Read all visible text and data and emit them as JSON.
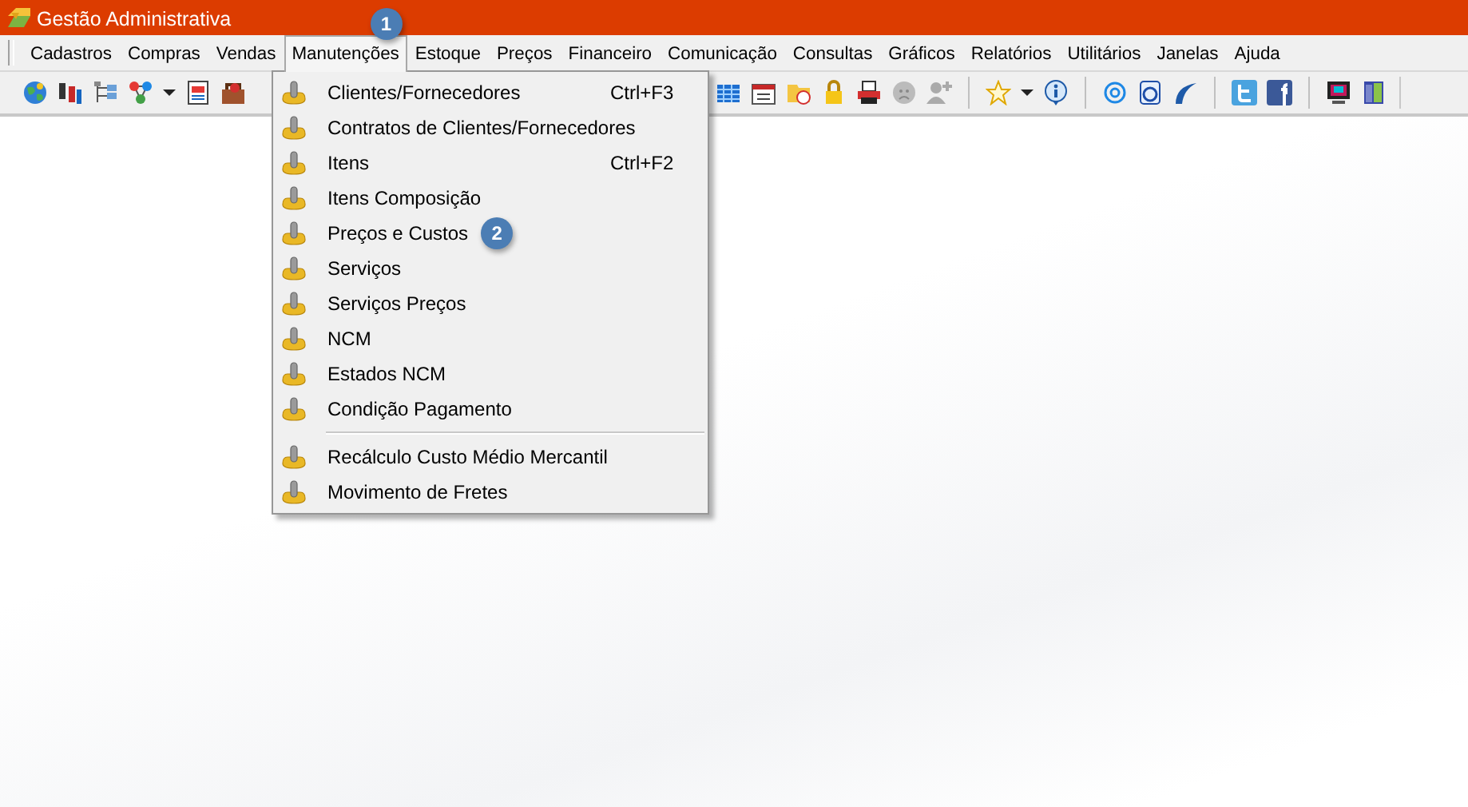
{
  "window": {
    "title": "Gestão Administrativa"
  },
  "menu_bar": [
    {
      "label": "Cadastros",
      "selected": false
    },
    {
      "label": "Compras",
      "selected": false
    },
    {
      "label": "Vendas",
      "selected": false
    },
    {
      "label": "Manutenções",
      "selected": true
    },
    {
      "label": "Estoque",
      "selected": false
    },
    {
      "label": "Preços",
      "selected": false
    },
    {
      "label": "Financeiro",
      "selected": false
    },
    {
      "label": "Comunicação",
      "selected": false
    },
    {
      "label": "Consultas",
      "selected": false
    },
    {
      "label": "Gráficos",
      "selected": false
    },
    {
      "label": "Relatórios",
      "selected": false
    },
    {
      "label": "Utilitários",
      "selected": false
    },
    {
      "label": "Janelas",
      "selected": false
    },
    {
      "label": "Ajuda",
      "selected": false
    }
  ],
  "dropdown": [
    {
      "kind": "item",
      "label": "Clientes/Fornecedores",
      "shortcut": "Ctrl+F3"
    },
    {
      "kind": "item",
      "label": "Contratos de Clientes/Fornecedores"
    },
    {
      "kind": "item",
      "label": "Itens",
      "shortcut": "Ctrl+F2"
    },
    {
      "kind": "item",
      "label": "Itens Composição"
    },
    {
      "kind": "item",
      "label": "Preços e Custos",
      "badge": "2"
    },
    {
      "kind": "item",
      "label": "Serviços"
    },
    {
      "kind": "item",
      "label": "Serviços Preços"
    },
    {
      "kind": "item",
      "label": "NCM"
    },
    {
      "kind": "item",
      "label": "Estados NCM"
    },
    {
      "kind": "item",
      "label": "Condição Pagamento"
    },
    {
      "kind": "separator"
    },
    {
      "kind": "item",
      "label": "Recálculo Custo Médio Mercantil"
    },
    {
      "kind": "item",
      "label": "Movimento de Fretes"
    }
  ],
  "menu_badge": "1"
}
